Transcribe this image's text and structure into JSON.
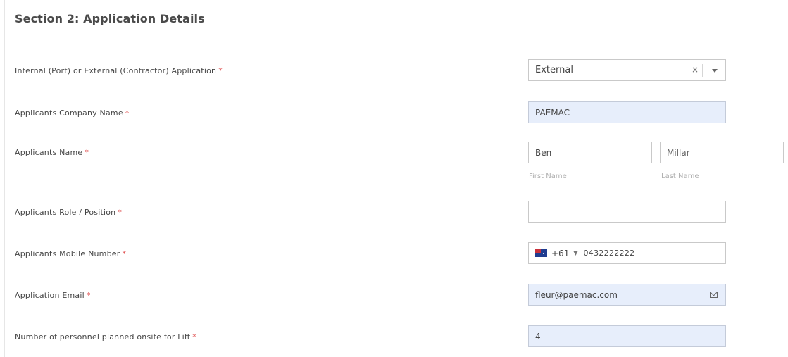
{
  "section": {
    "title": "Section 2: Application Details"
  },
  "required_marker": "*",
  "fields": {
    "application_type": {
      "label": "Internal (Port) or External (Contractor) Application",
      "value": "External",
      "clear_symbol": "×"
    },
    "company_name": {
      "label": "Applicants Company Name",
      "value": "PAEMAC"
    },
    "applicant_name": {
      "label": "Applicants Name",
      "first_value": "Ben",
      "last_value": "Millar",
      "first_hint": "First Name",
      "last_hint": "Last Name"
    },
    "role_position": {
      "label": "Applicants Role / Position",
      "value": ""
    },
    "mobile_number": {
      "label": "Applicants Mobile Number",
      "country_flag": "australia-flag-icon",
      "dial_code": "+61",
      "caret": "▼",
      "value": "0432222222"
    },
    "email": {
      "label": "Application Email",
      "value": "fleur@paemac.com",
      "icon": "envelope-icon"
    },
    "personnel_count": {
      "label": "Number of personnel planned onsite for Lift",
      "value": "4"
    }
  },
  "colors": {
    "required": "#e05050",
    "filled_background": "#e7eefb"
  }
}
